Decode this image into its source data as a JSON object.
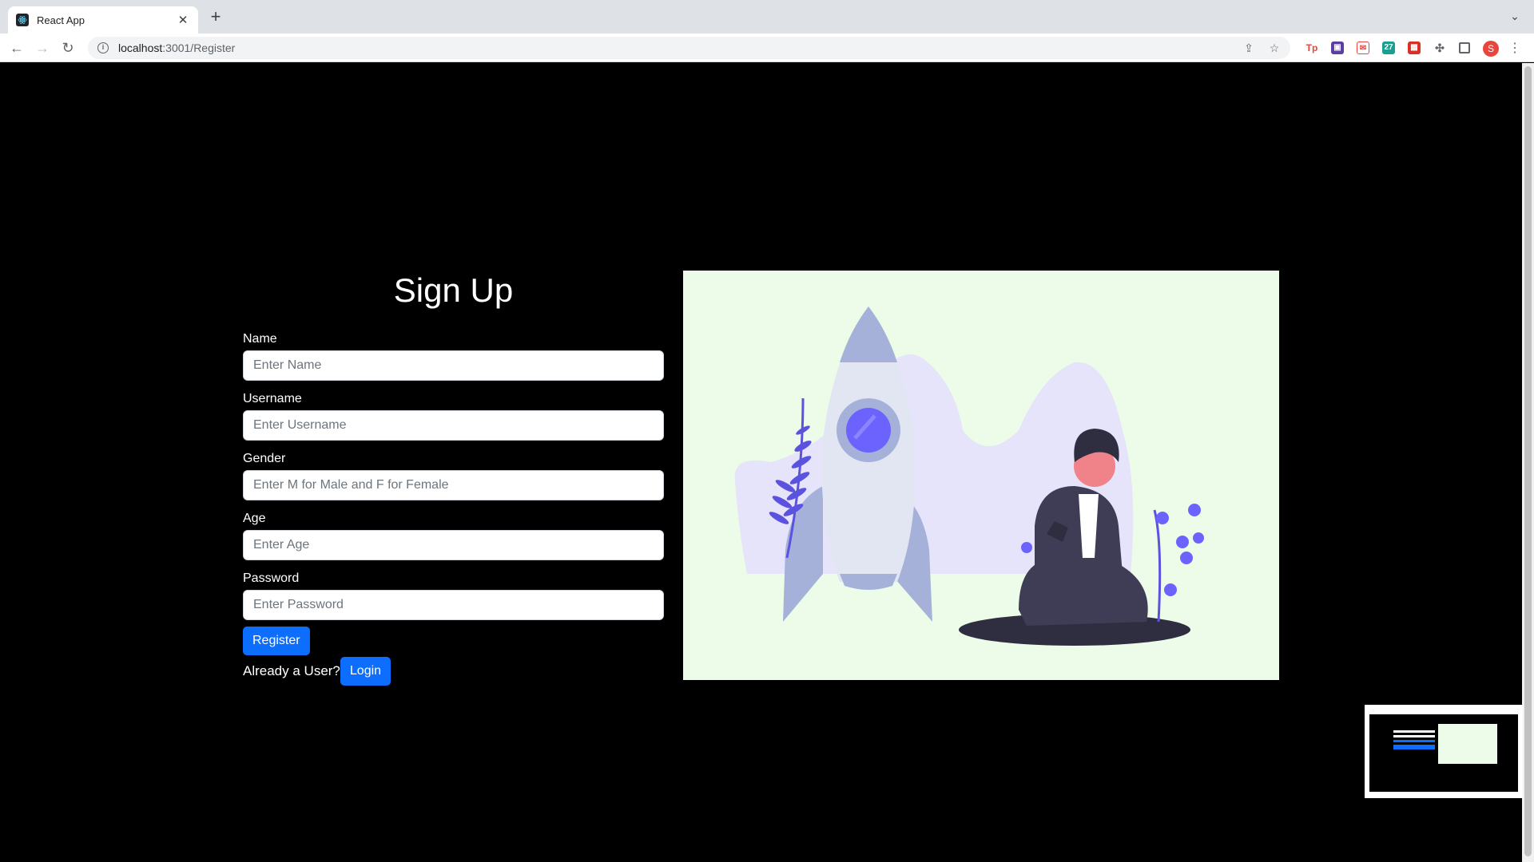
{
  "browser": {
    "tab_title": "React App",
    "url_host": "localhost",
    "url_path": ":3001/Register",
    "profile_initial": "S"
  },
  "form": {
    "heading": "Sign Up",
    "fields": [
      {
        "label": "Name",
        "placeholder": "Enter Name"
      },
      {
        "label": "Username",
        "placeholder": "Enter Username"
      },
      {
        "label": "Gender",
        "placeholder": "Enter M for Male and F for Female"
      },
      {
        "label": "Age",
        "placeholder": "Enter Age"
      },
      {
        "label": "Password",
        "placeholder": "Enter Password"
      }
    ],
    "register_label": "Register",
    "already_text": "Already a User?",
    "login_label": "Login"
  },
  "colors": {
    "button": "#0d6efd",
    "illustration_bg": "#edfce9",
    "accent_purple": "#6c63ff"
  },
  "icons": [
    "react-icon",
    "close-icon",
    "plus-icon",
    "chevron-down-icon",
    "back-arrow-icon",
    "forward-arrow-icon",
    "reload-icon",
    "info-icon",
    "share-icon",
    "star-icon",
    "puzzle-icon",
    "sidebar-icon",
    "more-vert-icon"
  ]
}
